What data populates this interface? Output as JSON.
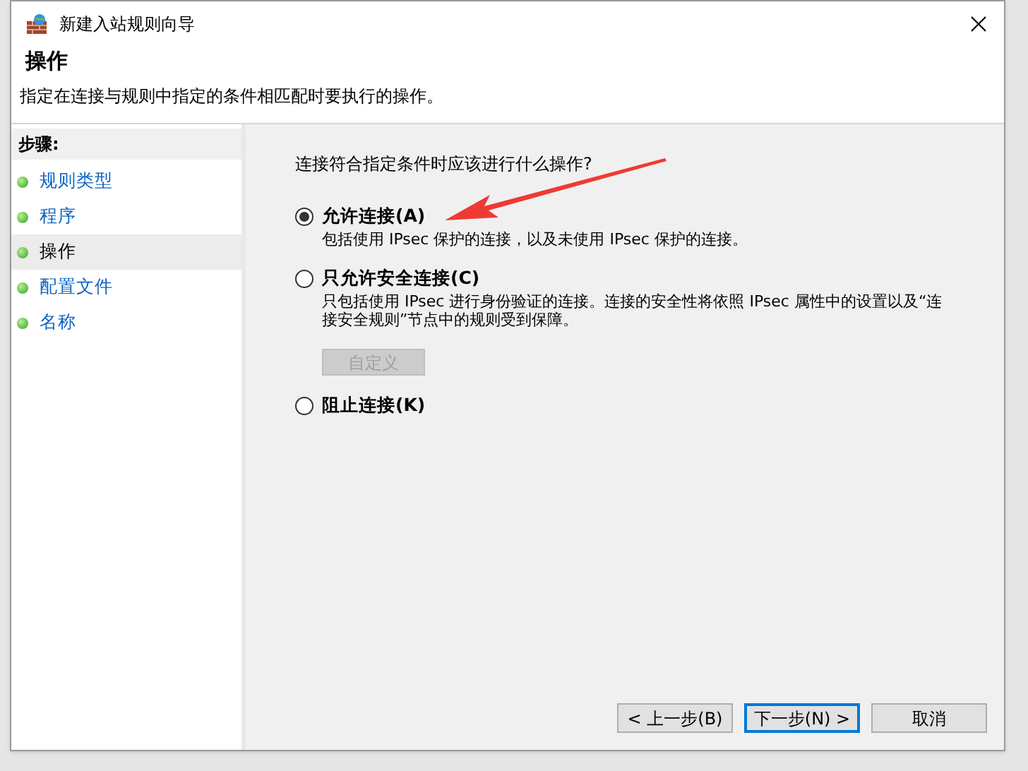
{
  "window": {
    "title": "新建入站规则向导"
  },
  "header": {
    "title": "操作",
    "description": "指定在连接与规则中指定的条件相匹配时要执行的操作。"
  },
  "steps": {
    "heading": "步骤:",
    "items": [
      {
        "label": "规则类型",
        "selected": false
      },
      {
        "label": "程序",
        "selected": false
      },
      {
        "label": "操作",
        "selected": true
      },
      {
        "label": "配置文件",
        "selected": false
      },
      {
        "label": "名称",
        "selected": false
      }
    ]
  },
  "question": "连接符合指定条件时应该进行什么操作?",
  "options": [
    {
      "label": "允许连接(A)",
      "selected": true,
      "description": "包括使用 IPsec 保护的连接，以及未使用 IPsec 保护的连接。"
    },
    {
      "label": "只允许安全连接(C)",
      "selected": false,
      "description": "只包括使用 IPsec 进行身份验证的连接。连接的安全性将依照 IPsec 属性中的设置以及“连接安全规则”节点中的规则受到保障。",
      "button": {
        "label": "自定义",
        "disabled": true
      }
    },
    {
      "label": "阻止连接(K)",
      "selected": false
    }
  ],
  "buttons": [
    {
      "label": "< 上一步(B)",
      "default": false
    },
    {
      "label": "下一步(N) >",
      "default": true
    },
    {
      "label": "取消",
      "default": false
    }
  ]
}
